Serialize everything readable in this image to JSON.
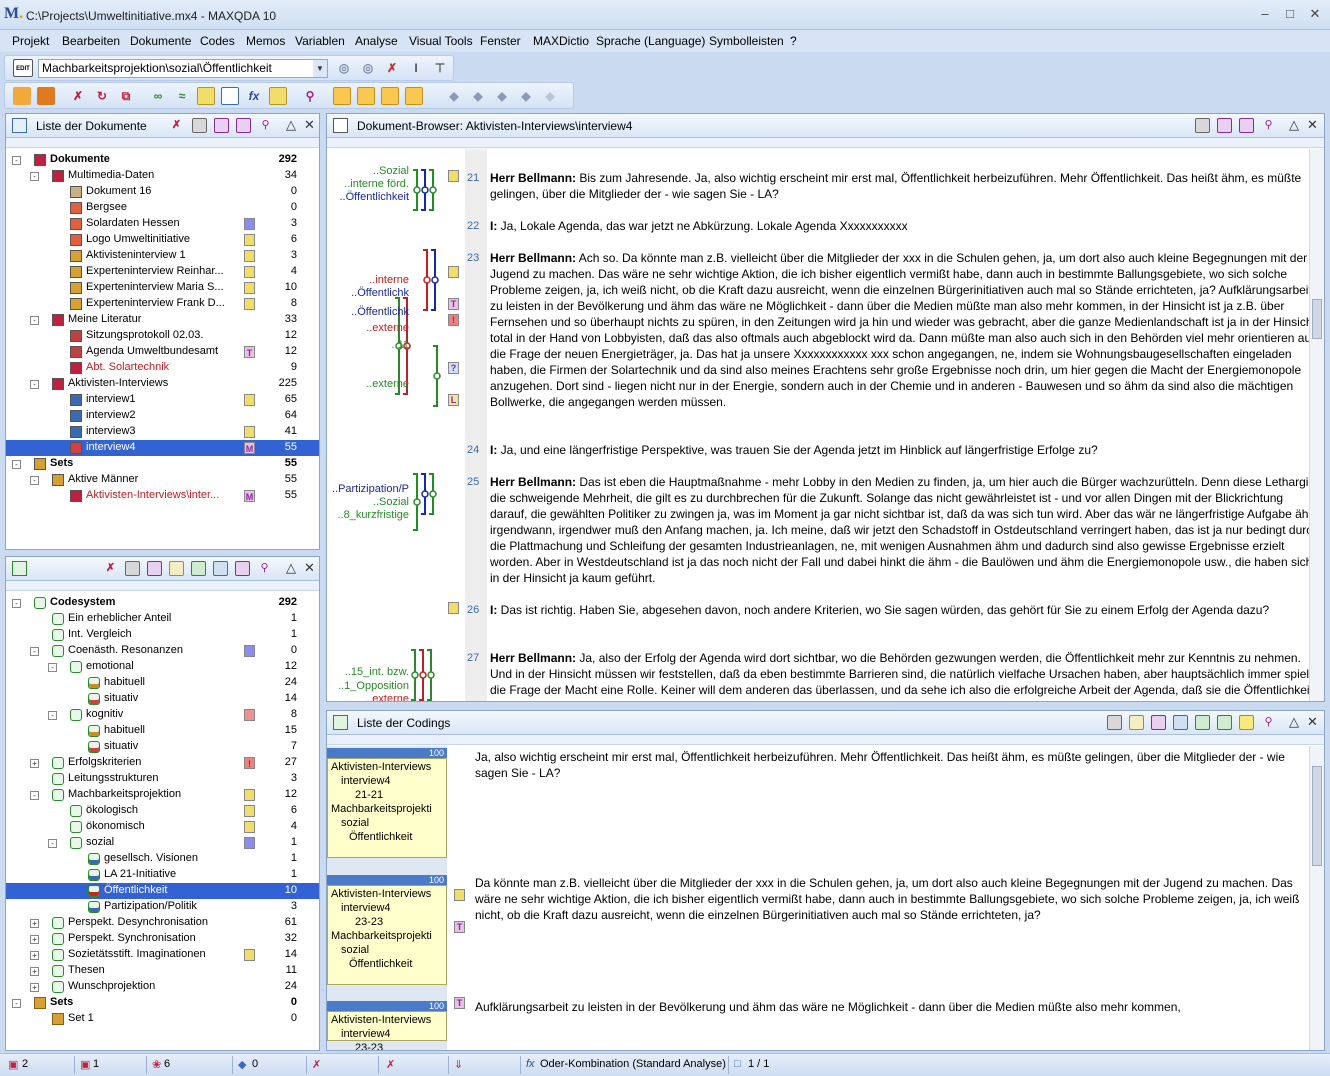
{
  "window": {
    "title": "C:\\Projects\\Umweltinitiative.mx4 - MAXQDA 10"
  },
  "menu": [
    "Projekt",
    "Bearbeiten",
    "Dokumente",
    "Codes",
    "Memos",
    "Variablen",
    "Analyse",
    "Visual Tools",
    "Fenster",
    "MAXDictio",
    "Sprache (Language)",
    "Symbolleisten",
    "?"
  ],
  "toolbar": {
    "combo_value": "Machbarkeitsprojektion\\sozial\\Öffentlichkeit",
    "edit_label": "EDIT"
  },
  "doclist": {
    "title": "Liste der Dokumente",
    "rows": [
      {
        "label": "Dokumente",
        "num": "292"
      },
      {
        "label": "Multimedia-Daten",
        "num": "34"
      },
      {
        "label": "Dokument 16",
        "num": "0"
      },
      {
        "label": "Bergsee",
        "num": "0"
      },
      {
        "label": "Solardaten Hessen",
        "num": "3"
      },
      {
        "label": "Logo Umweltinitiative",
        "num": "6"
      },
      {
        "label": "Aktivisteninterview 1",
        "num": "3"
      },
      {
        "label": "Experteninterview Reinhar...",
        "num": "4"
      },
      {
        "label": "Experteninterview Maria S...",
        "num": "10"
      },
      {
        "label": "Experteninterview Frank D...",
        "num": "8"
      },
      {
        "label": "Meine Literatur",
        "num": "33"
      },
      {
        "label": "Sitzungsprotokoll 02.03.",
        "num": "12"
      },
      {
        "label": "Agenda Umweltbundesamt",
        "num": "12"
      },
      {
        "label": "Abt. Solartechnik",
        "num": "9"
      },
      {
        "label": "Aktivisten-Interviews",
        "num": "225"
      },
      {
        "label": "interview1",
        "num": "65"
      },
      {
        "label": "interview2",
        "num": "64"
      },
      {
        "label": "interview3",
        "num": "41"
      },
      {
        "label": "interview4",
        "num": "55"
      },
      {
        "label": "Sets",
        "num": "55"
      },
      {
        "label": "Aktive Männer",
        "num": "55"
      },
      {
        "label": "Aktivisten-Interviews\\inter...",
        "num": "55"
      }
    ]
  },
  "codesys": {
    "rows": [
      {
        "label": "Codesystem",
        "num": "292"
      },
      {
        "label": "Ein erheblicher Anteil",
        "num": "1"
      },
      {
        "label": "Int. Vergleich",
        "num": "1"
      },
      {
        "label": "Coenästh. Resonanzen",
        "num": "0"
      },
      {
        "label": "emotional",
        "num": "12"
      },
      {
        "label": "habituell",
        "num": "24"
      },
      {
        "label": "situativ",
        "num": "14"
      },
      {
        "label": "kognitiv",
        "num": "8"
      },
      {
        "label": "habituell",
        "num": "15"
      },
      {
        "label": "situativ",
        "num": "7"
      },
      {
        "label": "Erfolgskriterien",
        "num": "27"
      },
      {
        "label": "Leitungsstrukturen",
        "num": "3"
      },
      {
        "label": "Machbarkeitsprojektion",
        "num": "12"
      },
      {
        "label": "ökologisch",
        "num": "6"
      },
      {
        "label": "ökonomisch",
        "num": "4"
      },
      {
        "label": "sozial",
        "num": "1"
      },
      {
        "label": "gesellsch. Visionen",
        "num": "1"
      },
      {
        "label": "LA 21-Initiative",
        "num": "1"
      },
      {
        "label": "Öffentlichkeit",
        "num": "10"
      },
      {
        "label": "Partizipation/Politik",
        "num": "3"
      },
      {
        "label": "Perspekt. Desynchronisation",
        "num": "61"
      },
      {
        "label": "Perspekt. Synchronisation",
        "num": "32"
      },
      {
        "label": "Sozietätsstift. Imaginationen",
        "num": "14"
      },
      {
        "label": "Thesen",
        "num": "11"
      },
      {
        "label": "Wunschprojektion",
        "num": "24"
      },
      {
        "label": "Sets",
        "num": "0"
      },
      {
        "label": "Set 1",
        "num": "0"
      }
    ]
  },
  "browser": {
    "title": "Dokument-Browser: Aktivisten-Interviews\\interview4",
    "paragraphs": [
      {
        "n": "21",
        "speaker": "Herr Bellmann:",
        "text": " Bis zum Jahresende. Ja, also wichtig erscheint mir erst mal, Öffentlichkeit herbeizuführen. Mehr Öffentlichkeit. Das heißt ähm, es müßte gelingen, über die Mitglieder der - wie sagen Sie - LA?"
      },
      {
        "n": "22",
        "speaker": "I:",
        "text": " Ja, Lokale Agenda, das war jetzt ne Abkürzung. Lokale Agenda Xxxxxxxxxxx"
      },
      {
        "n": "23",
        "speaker": "Herr Bellmann:",
        "text": " Ach so. Da könnte man z.B. vielleicht über die Mitglieder der xxx in die Schulen gehen, ja, um dort also auch kleine Begegnungen mit der Jugend zu machen. Das wäre ne sehr wichtige Aktion, die ich bisher eigentlich vermißt habe, dann auch in bestimmte Ballungsgebiete, wo sich solche Probleme zeigen, ja, ich weiß nicht, ob die Kraft dazu ausreicht, wenn die einzelnen Bürgerinitiativen auch mal so Stände errichteten, ja? Aufklärungsarbeit zu leisten in der Bevölkerung und ähm das wäre ne Möglichkeit - dann über die Medien müßte man also mehr kommen, in der Hinsicht ist ja z.B. über Fernsehen und so überhaupt nichts zu spüren, in den Zeitungen wird ja hin und wieder was gebracht, aber die ganze Medienlandschaft ist ja in der Hinsicht total in der Hand von Lobbyisten, daß das also oftmals auch abgeblockt wird da. Dann müßte man also auch sich in den Behörden viel mehr orientieren auf die Frage der neuen Energieträger, ja. Das hat ja unsere Xxxxxxxxxxxx xxx schon angegangen, ne, indem sie Wohnungsbaugesellschaften eingeladen haben, die Firmen der Solartechnik und da sind also meines Erachtens sehr große Ergebnisse noch drin, um hier gegen die Macht der Energiemonopole anzugehen. Dort sind - liegen nicht nur in der Energie, sondern auch in der Chemie und in anderen - Bauwesen und so ähm da sind also die mächtigen Bollwerke, die angegangen werden müssen."
      },
      {
        "n": "24",
        "speaker": "I:",
        "text": " Ja, und eine längerfristige Perspektive, was trauen Sie der Agenda jetzt im Hinblick auf längerfristige Erfolge zu?"
      },
      {
        "n": "25",
        "speaker": "Herr Bellmann:",
        "text": " Das ist eben die Hauptmaßnahme - mehr Lobby in den Medien zu finden, ja, um hier auch die Bürger wachzurütteln. Denn diese Lethargie, die schweigende Mehrheit, die gilt es zu durchbrechen für die Zukunft. Solange das nicht gewährleistet ist - und vor allen Dingen mit der Blickrichtung darauf, die gewählten Politiker zu zwingen ja, was im Moment ja gar nicht sichtbar ist, daß da was sich tun wird. Aber das wär ne längerfristige Aufgabe ähm irgendwann, irgendwer muß den Anfang machen, ja. Ich meine, daß wir jetzt den Schadstoff in Ostdeutschland verringert haben, das ist ja nur bedingt durch die Plattmachung und Schleifung der gesamten Industrieanlagen, ne, mit wenigen Ausnahmen ähm und dadurch sind also gewisse Ergebnisse erzielt worden. Aber in Westdeutschland ist ja das noch nicht der Fall und dabei hinkt die ähm - die Baulöwen und ähm die Energiemonopole usw., die haben sich in der Hinsicht ja kaum geführt."
      },
      {
        "n": "26",
        "speaker": "I:",
        "text": " Das ist richtig. Haben Sie, abgesehen davon, noch andere Kriterien, wo Sie sagen würden, das gehört für Sie zu einem Erfolg der Agenda dazu?"
      },
      {
        "n": "27",
        "speaker": "Herr Bellmann:",
        "text": " Ja, also der Erfolg der Agenda wird dort sichtbar, wo die Behörden gezwungen werden, die Öffentlichkeit mehr zur Kenntnis zu nehmen. Und in der Hinsicht müssen wir feststellen, daß da eben bestimmte Barrieren sind, die natürlich vielfache Ursachen haben, aber hauptsächlich immer spielt die Frage der Macht eine Rolle. Keiner will dem anderen das überlassen, und da sehe ich also die erfolgreiche Arbeit der Agenda, daß sie die Öffentlichkeit mobilisiert und die Macht aufbricht."
      }
    ],
    "code_labels": [
      "..Sozial",
      "..interne förd.",
      "..Öffentlichkeit",
      "..interne",
      "..Öffentlichk",
      "..Öffentlichk",
      "..externe",
      "..11",
      "..externe",
      "..Partizipation/P",
      "..Sozial",
      "..8_kurzfristige",
      "..15_int. bzw.",
      "..1_Opposition",
      "..externe"
    ]
  },
  "codings": {
    "title": "Liste der Codings",
    "items": [
      {
        "weight": "100",
        "doc": "Aktivisten-Interviews",
        "iv": "interview4",
        "range": "21-21",
        "code": "Machbarkeitsprojekti",
        "sub": "sozial",
        "leaf": "Öffentlichkeit",
        "text": "Ja, also wichtig erscheint mir erst mal, Öffentlichkeit herbeizuführen. Mehr Öffentlichkeit. Das heißt ähm, es müßte gelingen, über die Mitglieder der - wie sagen Sie - LA?"
      },
      {
        "weight": "100",
        "doc": "Aktivisten-Interviews",
        "iv": "interview4",
        "range": "23-23",
        "code": "Machbarkeitsprojekti",
        "sub": "sozial",
        "leaf": "Öffentlichkeit",
        "text": "Da könnte man z.B. vielleicht über die Mitglieder der xxx in die Schulen gehen, ja, um dort also auch kleine Begegnungen mit der Jugend zu machen. Das wäre ne sehr wichtige Aktion, die ich bisher eigentlich vermißt habe, dann auch in bestimmte Ballungsgebiete, wo sich solche Probleme zeigen, ja, ich weiß nicht, ob die Kraft dazu ausreicht, wenn die einzelnen Bürgerinitiativen auch mal so Stände errichteten, ja?"
      },
      {
        "weight": "100",
        "doc": "Aktivisten-Interviews",
        "iv": "interview4",
        "range": "23-23",
        "text": "Aufklärungsarbeit zu leisten in der Bevölkerung und ähm das wäre ne Möglichkeit - dann über die Medien müßte also mehr kommen,"
      }
    ]
  },
  "status": {
    "docs": "2",
    "codes": "1",
    "coded": "6",
    "sel": "0",
    "mode": "Oder-Kombination (Standard Analyse)",
    "page": "1 / 1"
  }
}
